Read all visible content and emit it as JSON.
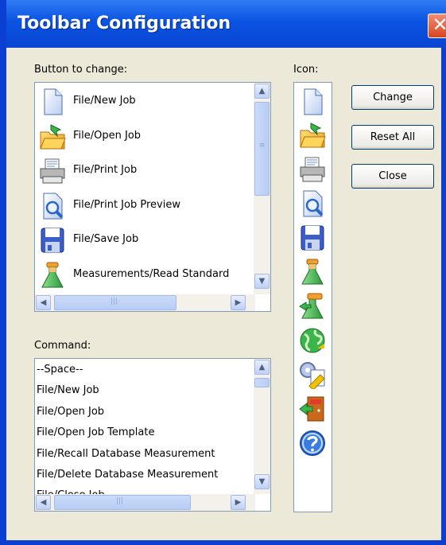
{
  "window": {
    "title": "Toolbar Configuration",
    "close_glyph": "✕"
  },
  "labels": {
    "button_to_change": "Button to change:",
    "icon": "Icon:",
    "command": "Command:"
  },
  "buttons": {
    "change": "Change",
    "reset_all": "Reset All",
    "close": "Close"
  },
  "button_list": [
    {
      "label": "File/New Job",
      "icon": "new-job-icon"
    },
    {
      "label": "File/Open Job",
      "icon": "open-job-icon"
    },
    {
      "label": "File/Print Job",
      "icon": "print-job-icon"
    },
    {
      "label": "File/Print Job Preview",
      "icon": "print-preview-icon"
    },
    {
      "label": "File/Save Job",
      "icon": "save-job-icon"
    },
    {
      "label": "Measurements/Read Standard",
      "icon": "read-standard-icon"
    }
  ],
  "command_list": [
    "--Space--",
    "File/New Job",
    "File/Open Job",
    "File/Open Job Template",
    "File/Recall Database Measurement",
    "File/Delete Database Measurement",
    "File/Close Job"
  ],
  "icon_strip": [
    "new-job-icon",
    "open-job-icon",
    "print-job-icon",
    "print-preview-icon",
    "save-job-icon",
    "read-standard-icon",
    "read-trial-icon",
    "globe-icon",
    "settings-icon",
    "exit-icon",
    "help-icon"
  ],
  "scroll_glyphs": {
    "up": "▲",
    "down": "▼",
    "left": "◀",
    "right": "▶",
    "grip_v": "≡",
    "grip_h": "|||"
  }
}
